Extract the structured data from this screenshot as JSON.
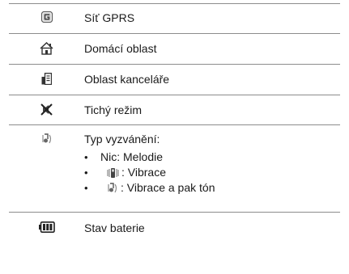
{
  "rows": [
    {
      "icon": "gprs-network-icon",
      "label": "Síť GPRS"
    },
    {
      "icon": "home-zone-icon",
      "label": "Domácí oblast"
    },
    {
      "icon": "office-zone-icon",
      "label": "Oblast kanceláře"
    },
    {
      "icon": "silent-mode-icon",
      "label": "Tichý režim"
    },
    {
      "icon": "ring-type-icon",
      "label": "Typ vyzvánění:",
      "items": [
        {
          "bullet": "•",
          "text": "Nic: Melodie"
        },
        {
          "bullet": "•",
          "icon": "vibrate-icon",
          "text": ": Vibrace"
        },
        {
          "bullet": "•",
          "icon": "vibrate-then-ring-icon",
          "text": ": Vibrace a pak tón"
        }
      ]
    },
    {
      "icon": "battery-status-icon",
      "label": "Stav baterie"
    }
  ]
}
